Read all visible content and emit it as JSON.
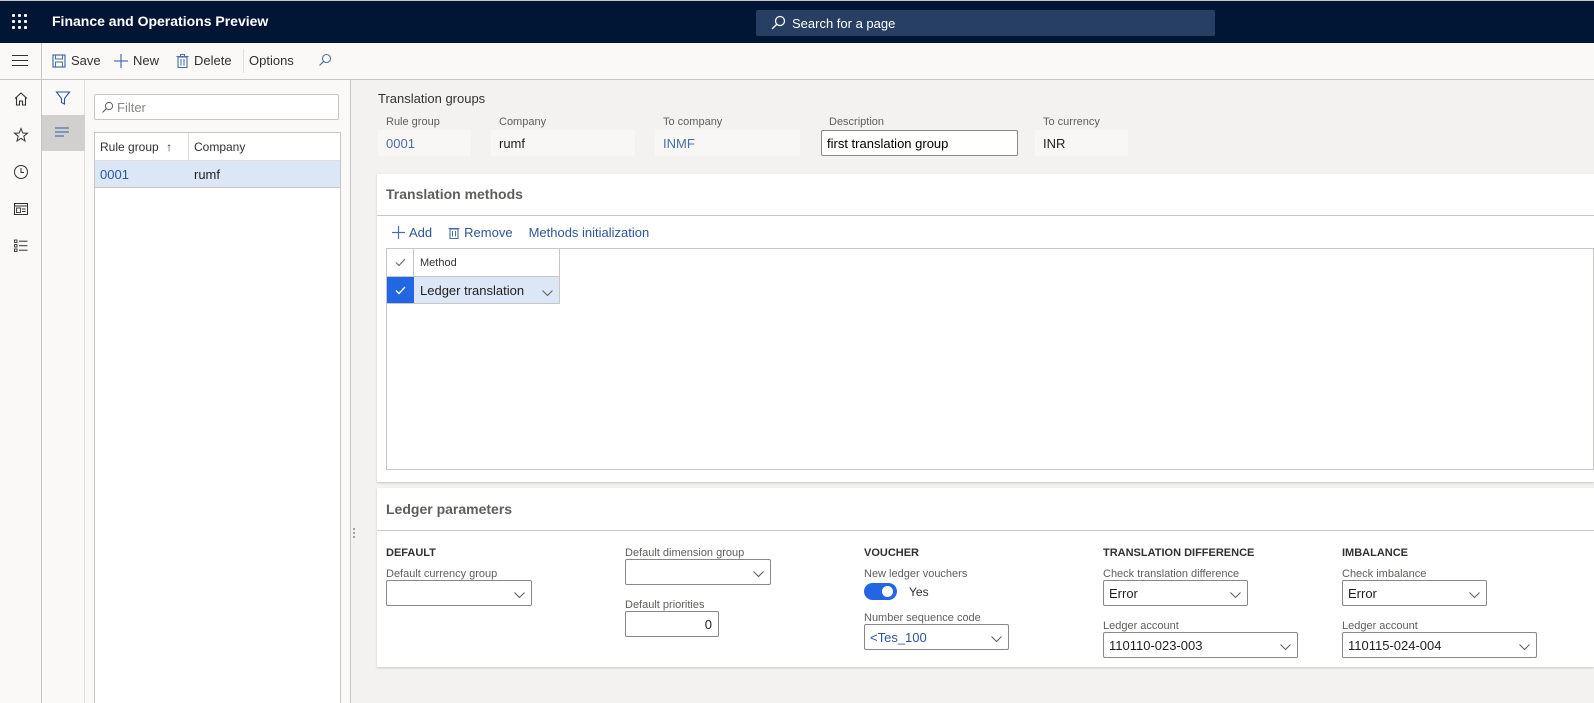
{
  "app": {
    "title": "Finance and Operations Preview",
    "search_placeholder": "Search for a page"
  },
  "action_pane": {
    "save": "Save",
    "new": "New",
    "delete": "Delete",
    "options": "Options"
  },
  "nav_rail": {
    "items": [
      "home",
      "favorites",
      "recent",
      "workspaces",
      "modules"
    ]
  },
  "list_pane": {
    "filter_placeholder": "Filter",
    "columns": [
      "Rule group",
      "Company"
    ],
    "sort_indicator": "↑",
    "rows": [
      {
        "rule_group": "0001",
        "company": "rumf"
      }
    ]
  },
  "header": {
    "title": "Translation groups",
    "fields": {
      "rule_group": {
        "label": "Rule group",
        "value": "0001"
      },
      "company": {
        "label": "Company",
        "value": "rumf"
      },
      "to_company": {
        "label": "To company",
        "value": "INMF"
      },
      "description": {
        "label": "Description",
        "value": "first translation group"
      },
      "to_currency": {
        "label": "To currency",
        "value": "INR"
      }
    }
  },
  "translation_methods": {
    "title": "Translation methods",
    "toolbar": {
      "add": "Add",
      "remove": "Remove",
      "methods_init": "Methods initialization"
    },
    "column": "Method",
    "rows": [
      {
        "method": "Ledger translation",
        "selected": true
      }
    ]
  },
  "ledger_parameters": {
    "title": "Ledger parameters",
    "default": {
      "heading": "DEFAULT",
      "currency_group_label": "Default currency group",
      "currency_group_value": "",
      "dimension_group_label": "Default dimension group",
      "dimension_group_value": "",
      "priorities_label": "Default priorities",
      "priorities_value": "0"
    },
    "voucher": {
      "heading": "VOUCHER",
      "new_vouchers_label": "New ledger vouchers",
      "new_vouchers_value": "Yes",
      "num_seq_label": "Number sequence code",
      "num_seq_value": "<Tes_100"
    },
    "translation_difference": {
      "heading": "TRANSLATION DIFFERENCE",
      "check_label": "Check translation difference",
      "check_value": "Error",
      "account_label": "Ledger account",
      "account_value": "110110-023-003"
    },
    "imbalance": {
      "heading": "IMBALANCE",
      "check_label": "Check imbalance",
      "check_value": "Error",
      "account_label": "Ledger account",
      "account_value": "110115-024-004"
    }
  },
  "colors": {
    "topbar": "#001634",
    "accent": "#2266e3",
    "link": "#2b579a",
    "selected_row": "#dbe6f7"
  }
}
